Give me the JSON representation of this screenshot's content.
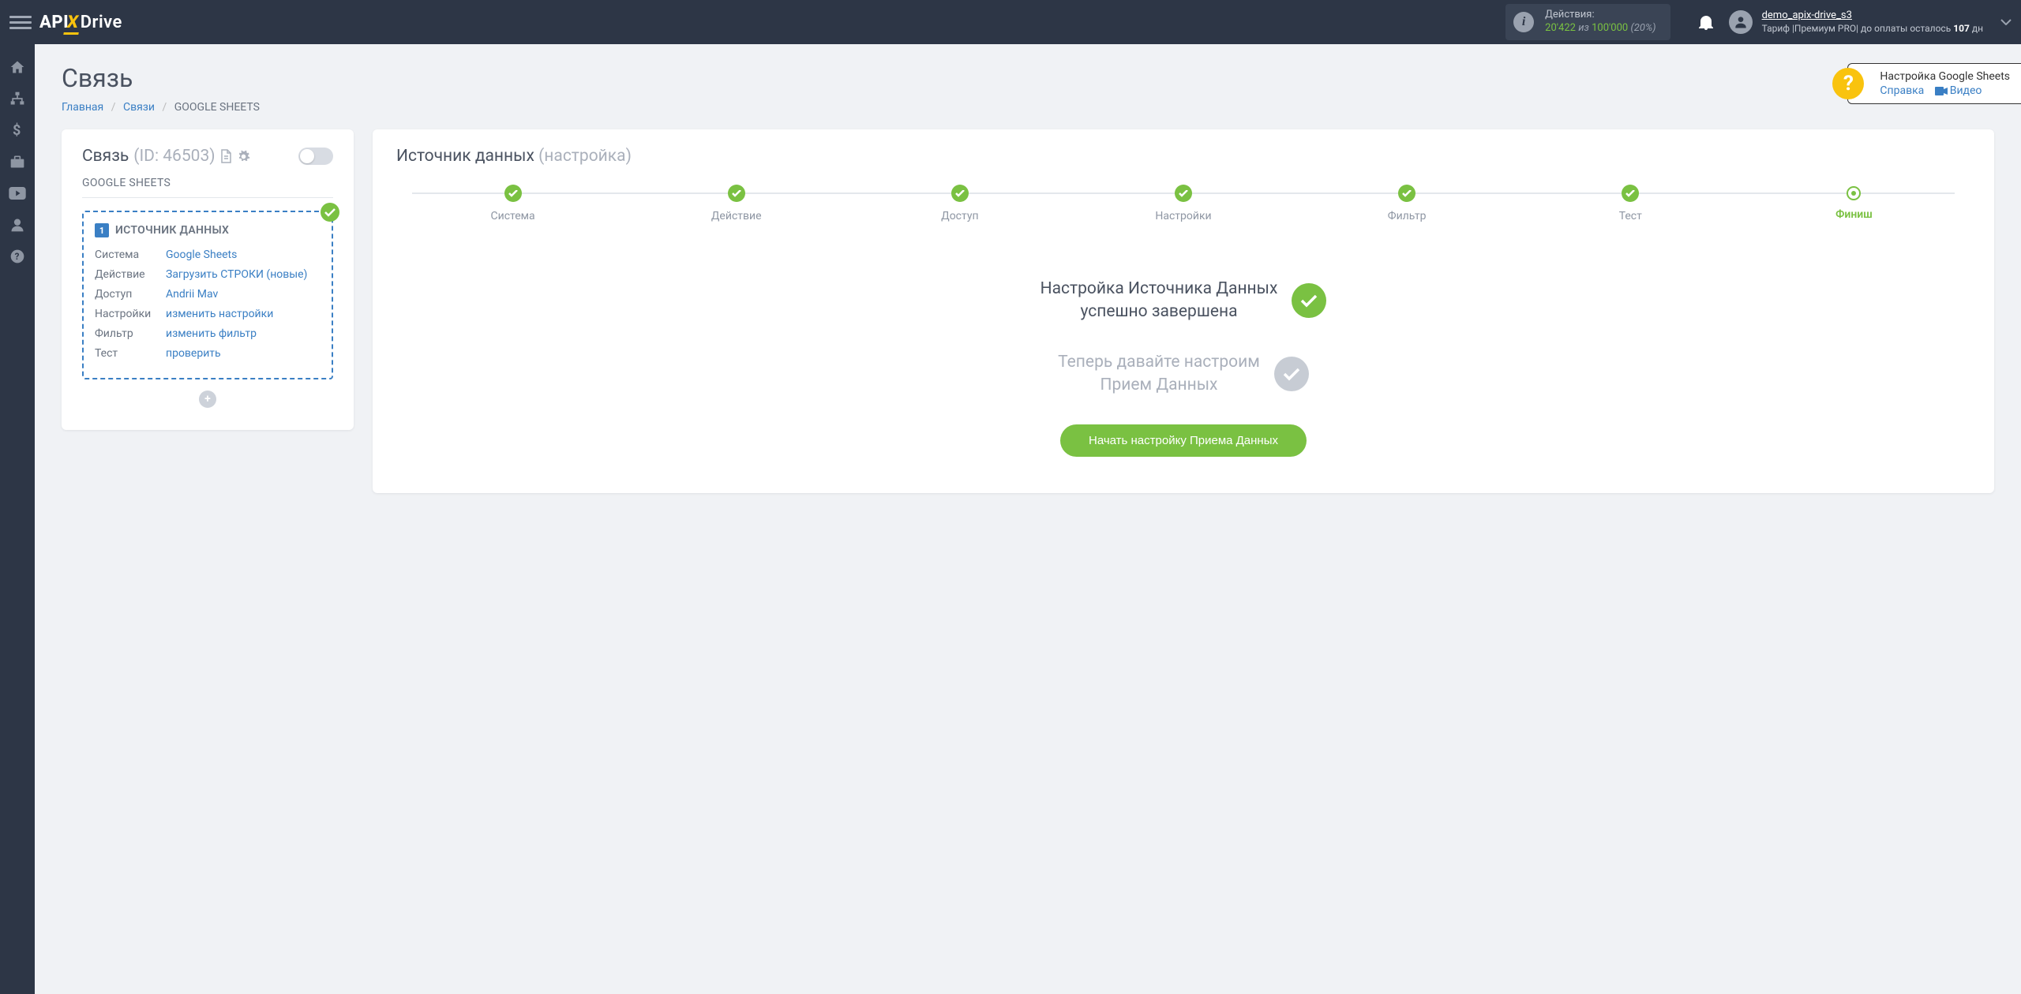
{
  "header": {
    "actions_label": "Действия:",
    "actions_used": "20'422",
    "actions_of": "из",
    "actions_total": "100'000",
    "actions_pct": "(20%)",
    "user_name": "demo_apix-drive_s3",
    "tariff_prefix": "Тариф  |Премиум PRO|  до оплаты осталось ",
    "tariff_days": "107",
    "tariff_suffix": " дн"
  },
  "page": {
    "title": "Связь",
    "breadcrumb": {
      "home": "Главная",
      "links": "Связи",
      "current": "GOOGLE SHEETS"
    }
  },
  "help": {
    "title": "Настройка Google Sheets",
    "ref": "Справка",
    "video": "Видео"
  },
  "left": {
    "label": "Связь",
    "id": "(ID: 46503)",
    "subtitle": "GOOGLE SHEETS",
    "box": {
      "num": "1",
      "title": "ИСТОЧНИК ДАННЫХ",
      "rows": {
        "system_k": "Система",
        "system_v": "Google Sheets",
        "action_k": "Действие",
        "action_v": "Загрузить СТРОКИ (новые)",
        "access_k": "Доступ",
        "access_v": "Andrii Mav",
        "settings_k": "Настройки",
        "settings_v": "изменить настройки",
        "filter_k": "Фильтр",
        "filter_v": "изменить фильтр",
        "test_k": "Тест",
        "test_v": "проверить"
      }
    }
  },
  "right": {
    "title_main": "Источник данных",
    "title_sub": "(настройка)",
    "steps": [
      "Система",
      "Действие",
      "Доступ",
      "Настройки",
      "Фильтр",
      "Тест",
      "Финиш"
    ],
    "success_line1": "Настройка Источника Данных",
    "success_line2": "успешно завершена",
    "next_line1": "Теперь давайте настроим",
    "next_line2": "Прием Данных",
    "cta": "Начать настройку Приема Данных"
  }
}
